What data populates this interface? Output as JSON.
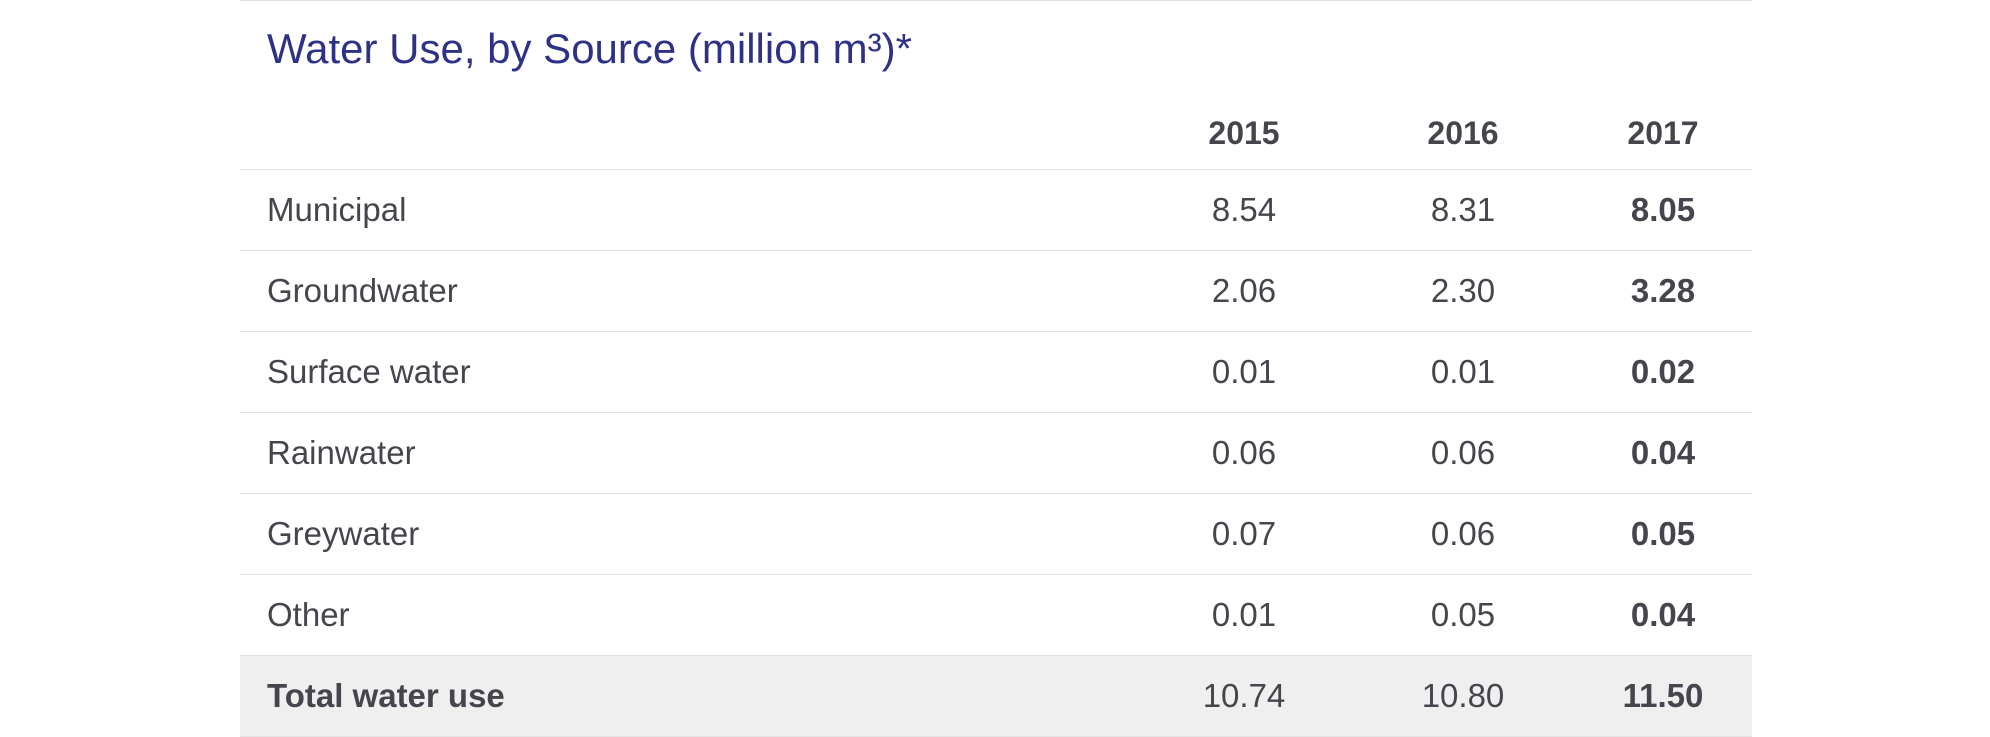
{
  "title": "Water Use, by Source (million m³)*",
  "columns": [
    "2015",
    "2016",
    "2017"
  ],
  "rows": [
    {
      "label": "Municipal",
      "values": [
        "8.54",
        "8.31",
        "8.05"
      ]
    },
    {
      "label": "Groundwater",
      "values": [
        "2.06",
        "2.30",
        "3.28"
      ]
    },
    {
      "label": "Surface water",
      "values": [
        "0.01",
        "0.01",
        "0.02"
      ]
    },
    {
      "label": "Rainwater",
      "values": [
        "0.06",
        "0.06",
        "0.04"
      ]
    },
    {
      "label": "Greywater",
      "values": [
        "0.07",
        "0.06",
        "0.05"
      ]
    },
    {
      "label": "Other",
      "values": [
        "0.01",
        "0.05",
        "0.04"
      ]
    }
  ],
  "total": {
    "label": "Total water use",
    "values": [
      "10.74",
      "10.80",
      "11.50"
    ]
  },
  "colors": {
    "title": "#2e3286",
    "text": "#45464d",
    "divider": "#e3e3e3",
    "total_background": "#efefef"
  }
}
